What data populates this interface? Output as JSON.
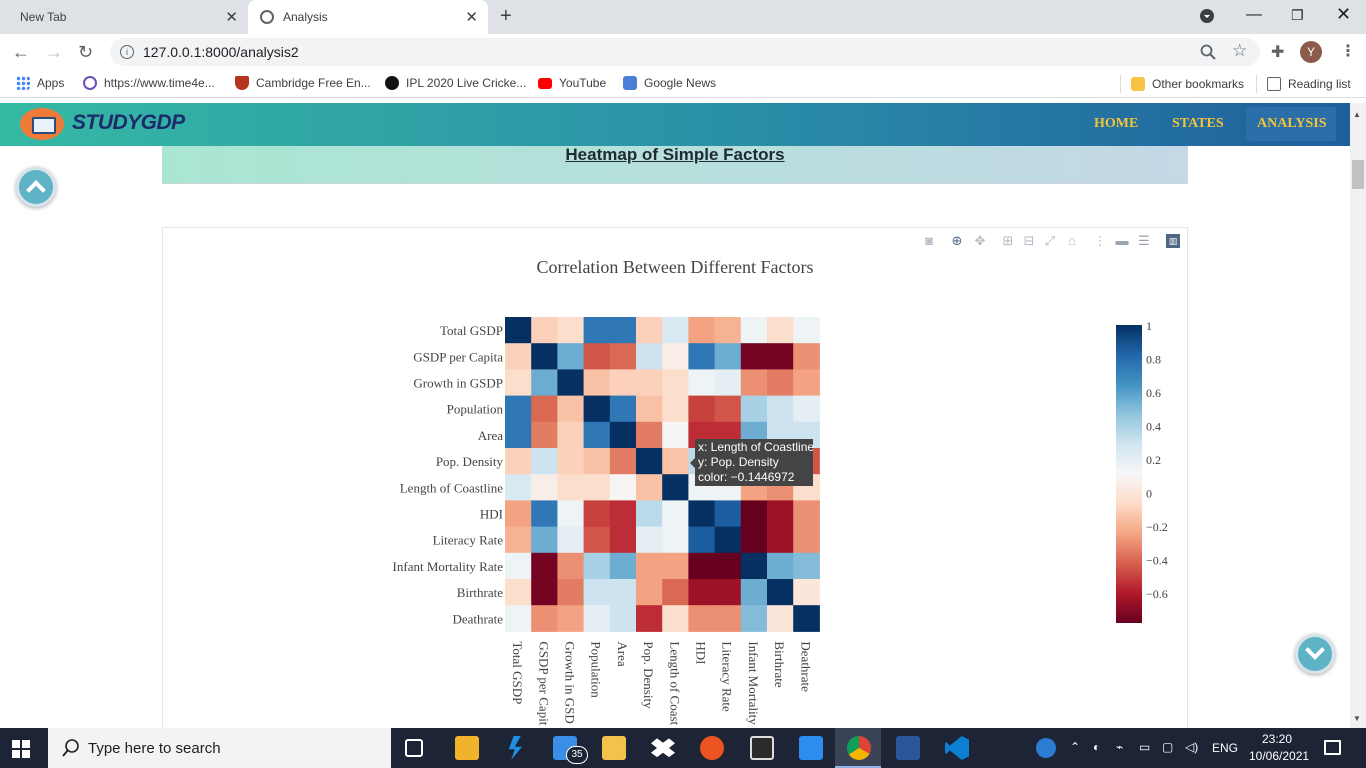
{
  "browser": {
    "tabs": [
      {
        "label": "New Tab"
      },
      {
        "label": "Analysis"
      }
    ],
    "close_glyph": "✕",
    "new_tab_glyph": "+",
    "address": "127.0.0.1:8000/analysis2",
    "avatar_initial": "Y",
    "bookmarks": [
      {
        "label": "Apps",
        "icon": "apps-grid-icon",
        "color": "#4285f4"
      },
      {
        "label": "https://www.time4e...",
        "icon": "globe-icon",
        "color": "#6b4fbb"
      },
      {
        "label": "Cambridge Free En...",
        "icon": "cambridge-shield-icon",
        "color": "#b5361d"
      },
      {
        "label": "IPL 2020 Live Cricke...",
        "icon": "cricbuzz-icon",
        "color": "#111111"
      },
      {
        "label": "YouTube",
        "icon": "youtube-icon",
        "color": "#ff0000"
      },
      {
        "label": "Google News",
        "icon": "google-news-icon",
        "color": "#4a7fd8"
      }
    ],
    "other_bookmarks": "Other bookmarks",
    "reading_list": "Reading list"
  },
  "site": {
    "logo_text": "STUDYGDP",
    "nav": [
      {
        "label": "HOME"
      },
      {
        "label": "STATES"
      },
      {
        "label": "ANALYSIS"
      }
    ],
    "banner_title": "Heatmap of Simple Factors"
  },
  "chart_data": {
    "type": "heatmap",
    "title": "Correlation Between Different Factors",
    "x": [
      "Total GSDP",
      "GSDP per Capita",
      "Growth in GSDP",
      "Population",
      "Area",
      "Pop. Density",
      "Length of Coastline",
      "HDI",
      "Literacy Rate",
      "Infant Mortality Rate",
      "Birthrate",
      "Deathrate"
    ],
    "y": [
      "Total GSDP",
      "GSDP per Capita",
      "Growth in GSDP",
      "Population",
      "Area",
      "Pop. Density",
      "Length of Coastline",
      "HDI",
      "Literacy Rate",
      "Infant Mortality Rate",
      "Birthrate",
      "Deathrate"
    ],
    "x_tick_labels": [
      "Total GSDP",
      "GSDP per Capit",
      "Growth in GSD",
      "Population",
      "Area",
      "Pop. Density",
      "Length of Coast",
      "HDI",
      "Literacy Rate",
      "Infant Mortality",
      "Birthrate",
      "Deathrate"
    ],
    "z": [
      [
        1.0,
        -0.1,
        -0.05,
        0.75,
        0.75,
        -0.1,
        0.25,
        -0.25,
        -0.2,
        0.15,
        -0.05,
        0.15
      ],
      [
        -0.1,
        1.0,
        0.55,
        -0.45,
        -0.4,
        0.3,
        0.05,
        0.75,
        0.55,
        -0.75,
        -0.75,
        -0.3
      ],
      [
        -0.05,
        0.55,
        1.0,
        -0.15,
        -0.1,
        -0.1,
        -0.05,
        0.15,
        0.2,
        -0.3,
        -0.35,
        -0.25
      ],
      [
        0.75,
        -0.4,
        -0.15,
        1.0,
        0.75,
        -0.15,
        -0.05,
        -0.5,
        -0.45,
        0.4,
        0.3,
        0.2
      ],
      [
        0.75,
        -0.35,
        -0.1,
        0.75,
        1.0,
        -0.35,
        0.1,
        -0.55,
        -0.55,
        0.55,
        0.3,
        0.3
      ],
      [
        -0.1,
        0.3,
        -0.1,
        -0.15,
        -0.35,
        1.0,
        -0.1446972,
        0.35,
        0.25,
        -0.25,
        -0.25,
        -0.45
      ],
      [
        0.25,
        0.05,
        -0.05,
        -0.05,
        0.1,
        -0.15,
        1.0,
        0.15,
        0.15,
        -0.25,
        -0.3,
        -0.05
      ],
      [
        -0.25,
        0.75,
        0.15,
        -0.5,
        -0.55,
        0.35,
        0.15,
        1.0,
        0.85,
        -0.9,
        -0.65,
        -0.3
      ],
      [
        -0.2,
        0.55,
        0.2,
        -0.45,
        -0.55,
        0.2,
        0.15,
        0.85,
        1.0,
        -0.85,
        -0.65,
        -0.3
      ],
      [
        0.15,
        -0.75,
        -0.3,
        0.4,
        0.55,
        -0.25,
        -0.25,
        -0.9,
        -0.85,
        1.0,
        0.55,
        0.5
      ],
      [
        -0.05,
        -0.75,
        -0.35,
        0.3,
        0.3,
        -0.25,
        -0.4,
        -0.65,
        -0.65,
        0.55,
        1.0,
        0.0
      ],
      [
        0.15,
        -0.3,
        -0.25,
        0.2,
        0.3,
        -0.55,
        -0.05,
        -0.3,
        -0.3,
        0.5,
        0.0,
        1.0
      ]
    ],
    "zlim": [
      -0.78,
      1.0
    ],
    "colorscale": "RdBu",
    "colorbar_ticks": [
      "1",
      "0.8",
      "0.6",
      "0.4",
      "0.2",
      "0",
      "−0.2",
      "−0.4",
      "−0.6"
    ],
    "tooltip": {
      "x_text": "x: Length of Coastline",
      "y_text": "y: Pop. Density",
      "color_text": "color: −0.1446972"
    }
  },
  "taskbar": {
    "search_placeholder": "Type here to search",
    "mail_badge": "35",
    "lang": "ENG",
    "time": "23:20",
    "date": "10/06/2021"
  }
}
